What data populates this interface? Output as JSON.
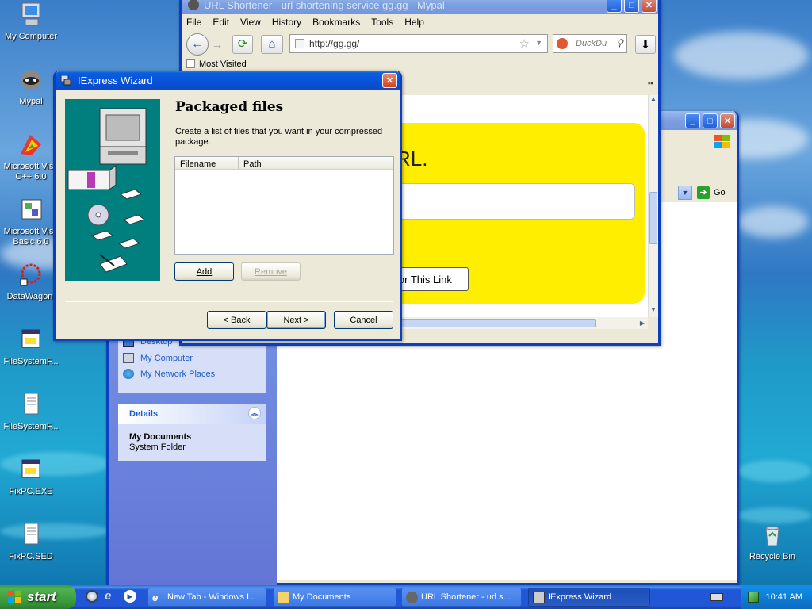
{
  "desktop_icons": [
    {
      "label": "My Computer"
    },
    {
      "label": "Mypal"
    },
    {
      "label": "Microsoft Visu C++ 6.0"
    },
    {
      "label": "Microsoft Visu Basic 6.0"
    },
    {
      "label": "DataWagon."
    },
    {
      "label": "FileSystemF..."
    },
    {
      "label": "FileSystemF..."
    },
    {
      "label": "FixPC.EXE"
    },
    {
      "label": "FixPC.SED"
    },
    {
      "label": "Recycle Bin"
    }
  ],
  "browser": {
    "title": "URL Shortener - url shortening service gg.gg - Mypal",
    "menu": [
      "File",
      "Edit",
      "View",
      "History",
      "Bookmarks",
      "Tools",
      "Help"
    ],
    "url": "http://gg.gg/",
    "search_placeholder": "DuckDu",
    "bookmark": "Most Visited",
    "heading_partial": "RL.",
    "button_partial": "e For This Link"
  },
  "explorer": {
    "go_label": "Go",
    "other_places": [
      "Desktop",
      "My Computer",
      "My Network Places"
    ],
    "details_title": "Details",
    "details_name": "My Documents",
    "details_type": "System Folder"
  },
  "wizard": {
    "title": "IExpress Wizard",
    "heading": "Packaged files",
    "description": "Create a list of files that you want in your compressed package.",
    "columns": [
      "Filename",
      "Path"
    ],
    "add_label": "Add",
    "remove_label": "Remove",
    "back_label": "< Back",
    "next_label": "Next >",
    "cancel_label": "Cancel"
  },
  "taskbar": {
    "start_label": "start",
    "tasks": [
      {
        "label": "New Tab - Windows I..."
      },
      {
        "label": "My Documents"
      },
      {
        "label": "URL Shortener - url s..."
      },
      {
        "label": "IExpress Wizard"
      }
    ],
    "clock": "10:41 AM"
  },
  "colors": {
    "xp_blue": "#0a5ee0",
    "highlight_yellow": "#ffee00",
    "wizard_teal": "#007f7f"
  }
}
